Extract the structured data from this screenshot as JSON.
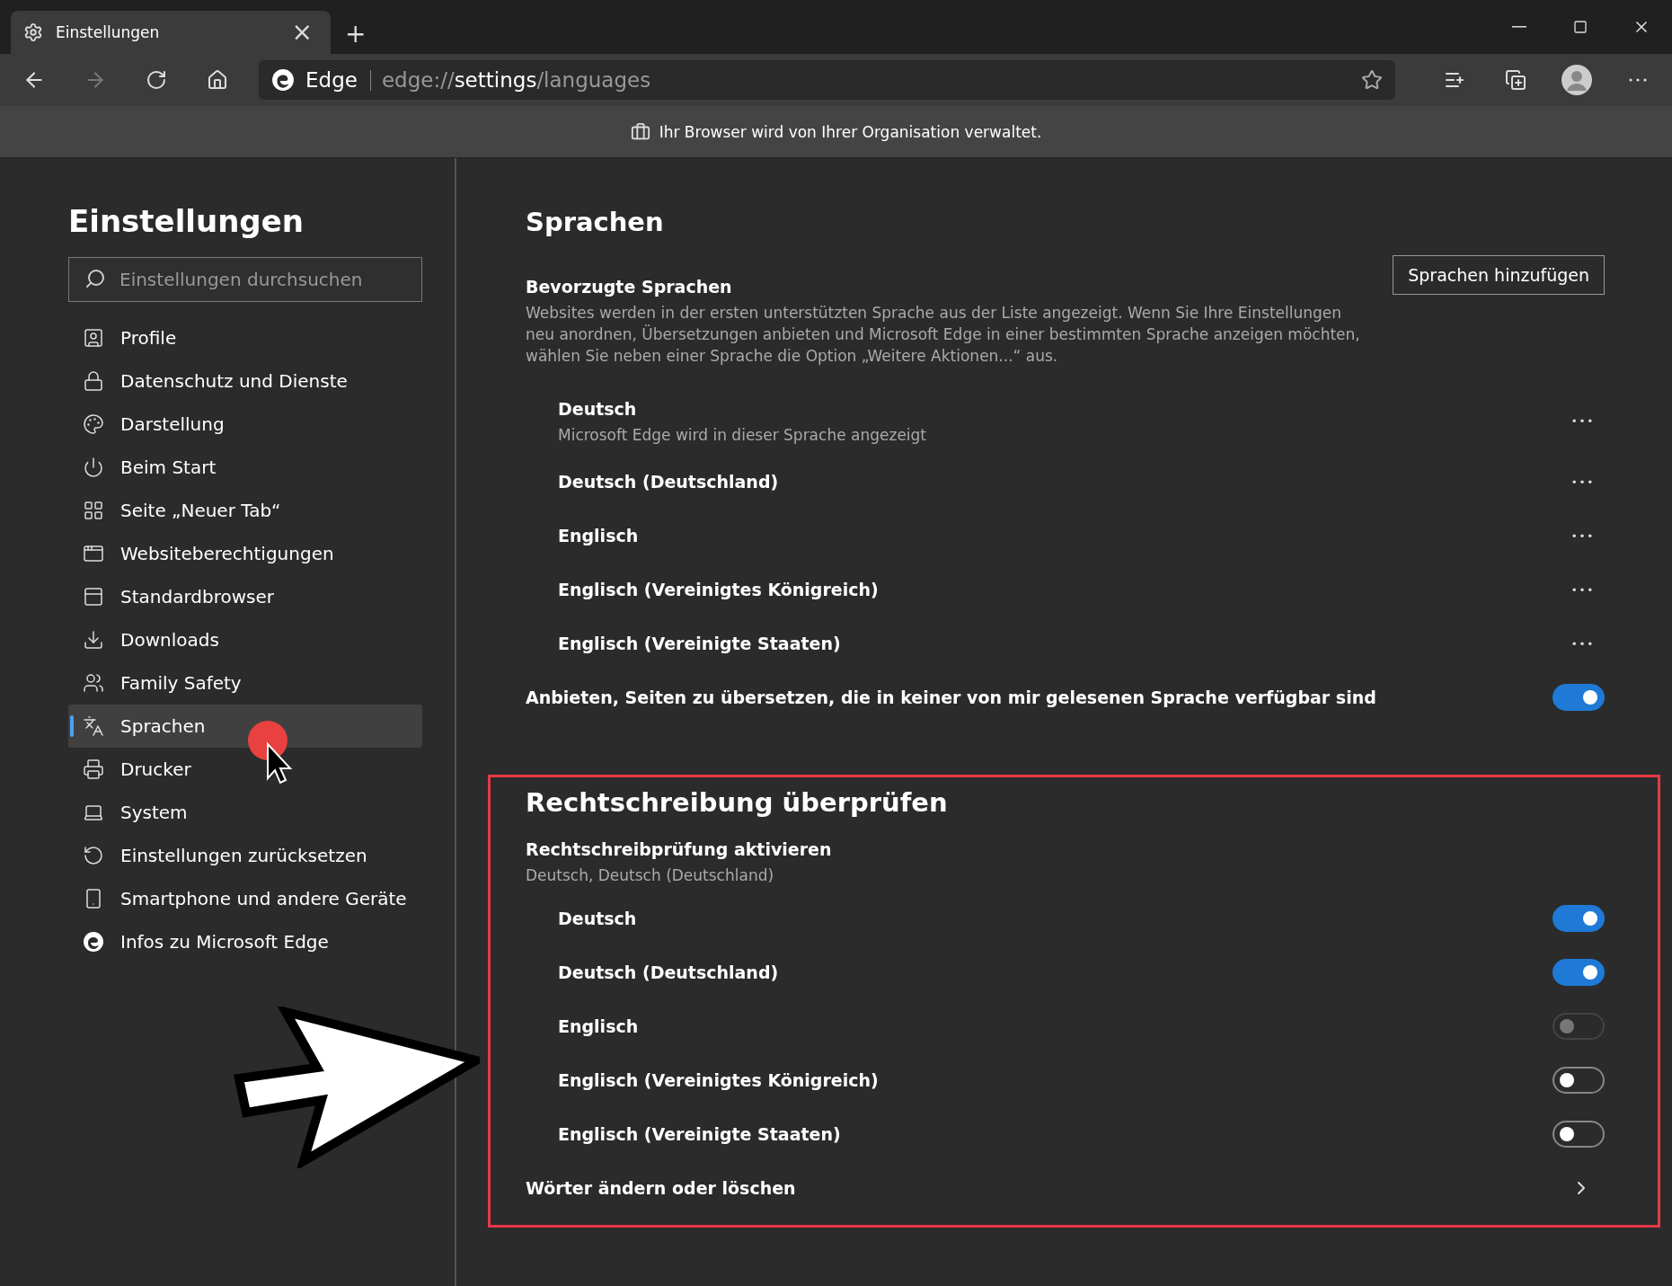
{
  "tab": {
    "title": "Einstellungen",
    "close": "×",
    "new": "+"
  },
  "address": {
    "brand": "Edge",
    "scheme": "edge://",
    "host": "settings",
    "path": "/languages"
  },
  "managed_bar": {
    "text": "Ihr Browser wird von Ihrer Organisation verwaltet."
  },
  "sidebar": {
    "title": "Einstellungen",
    "search": {
      "placeholder": "Einstellungen durchsuchen"
    },
    "items": [
      {
        "label": "Profile",
        "selected": false
      },
      {
        "label": "Datenschutz und Dienste",
        "selected": false
      },
      {
        "label": "Darstellung",
        "selected": false
      },
      {
        "label": "Beim Start",
        "selected": false
      },
      {
        "label": "Seite „Neuer Tab“",
        "selected": false
      },
      {
        "label": "Websiteberechtigungen",
        "selected": false
      },
      {
        "label": "Standardbrowser",
        "selected": false
      },
      {
        "label": "Downloads",
        "selected": false
      },
      {
        "label": "Family Safety",
        "selected": false
      },
      {
        "label": "Sprachen",
        "selected": true
      },
      {
        "label": "Drucker",
        "selected": false
      },
      {
        "label": "System",
        "selected": false
      },
      {
        "label": "Einstellungen zurücksetzen",
        "selected": false
      },
      {
        "label": "Smartphone und andere Geräte",
        "selected": false
      },
      {
        "label": "Infos zu Microsoft Edge",
        "selected": false
      }
    ]
  },
  "languages": {
    "title": "Sprachen",
    "preferred_title": "Bevorzugte Sprachen",
    "add_button": "Sprachen hinzufügen",
    "description": "Websites werden in der ersten unterstützten Sprache aus der Liste angezeigt. Wenn Sie Ihre Einstellungen neu anordnen, Übersetzungen anbieten und Microsoft Edge in einer bestimmten Sprache anzeigen möchten, wählen Sie neben einer Sprache die Option „Weitere Aktionen...“ aus.",
    "items": [
      {
        "name": "Deutsch",
        "note": "Microsoft Edge wird in dieser Sprache angezeigt"
      },
      {
        "name": "Deutsch (Deutschland)"
      },
      {
        "name": "Englisch"
      },
      {
        "name": "Englisch (Vereinigtes Königreich)"
      },
      {
        "name": "Englisch (Vereinigte Staaten)"
      }
    ],
    "translate": {
      "label": "Anbieten, Seiten zu übersetzen, die in keiner von mir gelesenen Sprache verfügbar sind",
      "on": true
    }
  },
  "spellcheck": {
    "title": "Rechtschreibung überprüfen",
    "enable_title": "Rechtschreibprüfung aktivieren",
    "enable_sub": "Deutsch, Deutsch (Deutschland)",
    "items": [
      {
        "name": "Deutsch",
        "on": true,
        "disabled": false
      },
      {
        "name": "Deutsch (Deutschland)",
        "on": true,
        "disabled": false
      },
      {
        "name": "Englisch",
        "on": false,
        "disabled": true
      },
      {
        "name": "Englisch (Vereinigtes Königreich)",
        "on": false,
        "disabled": false
      },
      {
        "name": "Englisch (Vereinigte Staaten)",
        "on": false,
        "disabled": false
      }
    ],
    "words_link": "Wörter ändern oder löschen"
  }
}
